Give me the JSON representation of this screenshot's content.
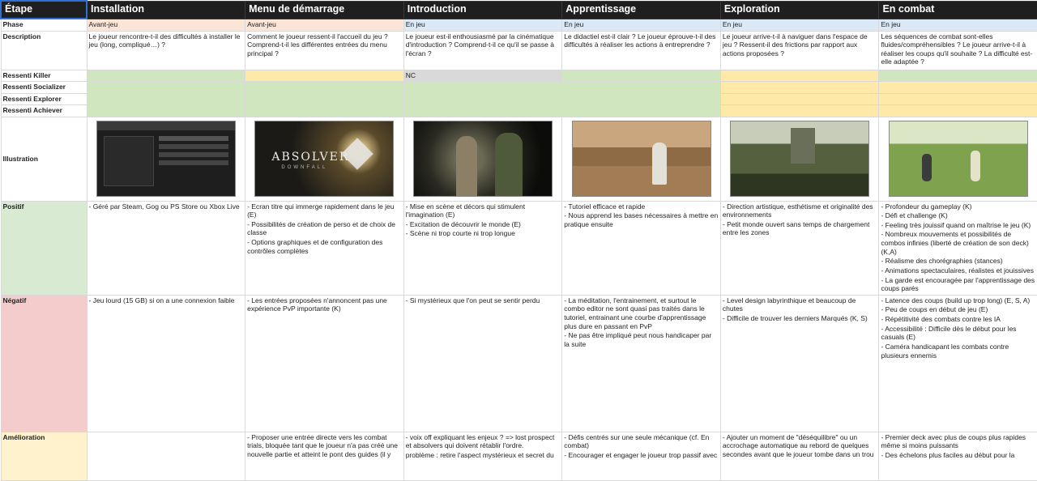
{
  "labels": {
    "etape": "Étape",
    "phase": "Phase",
    "description": "Description",
    "killer": "Ressenti Killer",
    "socializer": "Ressenti Socializer",
    "explorer": "Ressenti Explorer",
    "achiever": "Ressenti Achiever",
    "illustration": "Illustration",
    "positif": "Positif",
    "negatif": "Négatif",
    "amelioration": "Amélioration"
  },
  "stages": [
    {
      "title": "Installation",
      "phase": "Avant-jeu",
      "description": "Le joueur rencontre-t-il des difficultés à installer le jeu (long, compliqué…) ?",
      "feel": {
        "killer": "",
        "socializer": "",
        "explorer": "",
        "achiever": ""
      },
      "positif": [
        "- Géré par Steam, Gog ou PS Store ou Xbox Live"
      ],
      "negatif": [
        "- Jeu lourd (15 GB) si on a une connexion faible"
      ],
      "amelioration": []
    },
    {
      "title": "Menu de démarrage",
      "phase": "Avant-jeu",
      "description": "Comment le joueur ressent-il l'accueil du jeu ? Comprend-t-il les différentes entrées du menu principal ?",
      "feel": {
        "killer": "",
        "socializer": "",
        "explorer": "",
        "achiever": ""
      },
      "illustration_logo": "ABSOLVER",
      "illustration_sub": "DOWNFALL",
      "positif": [
        "- Ecran titre qui immerge rapidement dans le jeu (E)",
        "- Possibilités de création de perso et de choix de classe",
        "- Options graphiques et de configuration des contrôles complètes"
      ],
      "negatif": [
        "- Les entrées proposées n'annoncent pas une expérience PvP importante (K)"
      ],
      "amelioration": [
        "- Proposer une entrée directe vers les combat trials, bloquée tant que le joueur n'a pas créé une nouvelle partie et atteint le pont des guides (il y"
      ]
    },
    {
      "title": "Introduction",
      "phase": "En jeu",
      "description": "Le joueur est-il enthousiasmé par la cinématique d'introduction ? Comprend-t-il ce qu'il se passe à l'écran ?",
      "feel": {
        "killer": "NC",
        "socializer": "",
        "explorer": "",
        "achiever": ""
      },
      "positif": [
        "- Mise en scène et décors qui stimulent l'imagination (E)",
        "- Excitation de découvrir le monde (E)",
        "- Scène ni trop courte ni trop longue"
      ],
      "negatif": [
        "- Si mystérieux que l'on peut se sentir perdu"
      ],
      "amelioration": [
        "- voix off expliquant les enjeux ? => lost prospect et absolvers qui doivent rétablir l'ordre.",
        "problème : retire l'aspect mystérieux et secret du"
      ]
    },
    {
      "title": "Apprentissage",
      "phase": "En jeu",
      "description": "Le didactiel est-il clair ? Le joueur éprouve-t-il des difficultés à réaliser les actions à entreprendre ?",
      "feel": {
        "killer": "",
        "socializer": "",
        "explorer": "",
        "achiever": ""
      },
      "positif": [
        "- Tutoriel efficace et rapide",
        "- Nous apprend les bases nécessaires à mettre en pratique ensuite"
      ],
      "negatif": [
        "- La méditation, l'entrainement, et surtout le combo editor ne sont quasi pas traités dans le tutoriel, entrainant une courbe d'apprentissage plus dure en passant en PvP",
        "- Ne pas être impliqué peut nous handicaper par la suite"
      ],
      "amelioration": [
        "- Défis centrés sur une seule mécanique (cf. En combat)",
        "- Encourager et engager le joueur trop passif avec"
      ]
    },
    {
      "title": "Exploration",
      "phase": "En jeu",
      "description": "Le joueur arrive-t-il à naviguer dans l'espace de jeu ? Ressent-il des frictions par rapport aux actions proposées ?",
      "feel": {
        "killer": "",
        "socializer": "",
        "explorer": "",
        "achiever": ""
      },
      "positif": [
        "- Direction artistique, esthétisme et originalité des environnements",
        "- Petit monde ouvert sans temps de chargement entre les zones"
      ],
      "negatif": [
        "- Level design labyrinthique et beaucoup de chutes",
        "- Difficile de trouver les derniers Marqués (K, S)"
      ],
      "amelioration": [
        "- Ajouter un moment de \"déséquilibre\" ou un accrochage automatique au rebord de quelques secondes avant que le joueur tombe dans un trou"
      ]
    },
    {
      "title": "En combat",
      "phase": "En jeu",
      "description": "Les séquences de combat sont-elles fluides/compréhensibles ? Le joueur arrive-t-il à réaliser les coups qu'il souhaite ? La difficulté est-elle adaptée ?",
      "feel": {
        "killer": "",
        "socializer": "",
        "explorer": "",
        "achiever": ""
      },
      "positif": [
        "- Profondeur du gameplay (K)",
        "- Défi et challenge (K)",
        "- Feeling très jouissif quand on maîtrise le jeu (K)",
        "- Nombreux mouvements et possibilités de combos infinies (liberté de création de son deck) (K,A)",
        "- Réalisme des chorégraphies (stances)",
        "- Animations spectaculaires, réalistes et jouissives",
        "- La garde est encouragée par l'apprentissage des coups parés"
      ],
      "negatif": [
        "- Latence des coups (build up trop long) (E, S, A)",
        "- Peu de coups en début de jeu (E)",
        "- Répétitivité des combats contre les IA",
        "- Accessibilité : Difficile dès le début pour les casuals (E)",
        "- Caméra handicapant les combats contre plusieurs ennemis"
      ],
      "amelioration": [
        "- Premier deck avec plus de coups plus rapides même si moins puissants",
        "- Des échelons plus faciles au début pour la"
      ]
    }
  ],
  "colors": {
    "header_bg": "#1f1f1f",
    "phase_avant": "#fbe5d6",
    "phase_jeu": "#dbe8f5",
    "feel_green": "#cfe6bf",
    "feel_yellow": "#ffe9a8",
    "feel_nc": "#d9d9d9",
    "positif": "#d9ead3",
    "negatif": "#f4cccc",
    "amelioration": "#fff2cc",
    "selection": "#2f6fd6"
  }
}
